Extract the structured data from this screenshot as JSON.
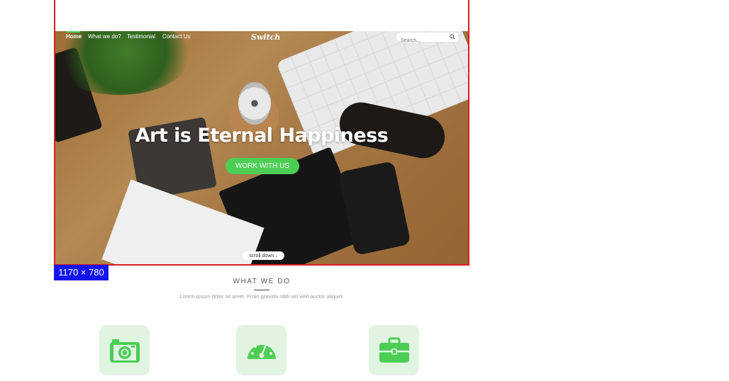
{
  "nav": {
    "items": [
      {
        "label": "Home",
        "active": true
      },
      {
        "label": "What we do?"
      },
      {
        "label": "Testimonial"
      },
      {
        "label": "Contact Us"
      }
    ],
    "brand": "Switch",
    "search": {
      "placeholder": "Search..."
    }
  },
  "hero": {
    "headline": "Art is Eternal Happiness",
    "cta_label": "WORK WITH US",
    "scroll_label": "scroll down ↓"
  },
  "viewport_badge": "1170 × 780",
  "section": {
    "title": "WHAT WE DO",
    "subtitle": "Lorem ipsum dolor sit amet. Proin gravida nibh vel velit auctor aliquet."
  },
  "features": [
    {
      "icon": "camera-icon"
    },
    {
      "icon": "speedometer-icon"
    },
    {
      "icon": "briefcase-icon"
    }
  ],
  "colors": {
    "accent": "#4cce55",
    "feature_tile": "#e1f4e2",
    "frame_border": "#d81f1f",
    "badge": "#1213f0"
  }
}
